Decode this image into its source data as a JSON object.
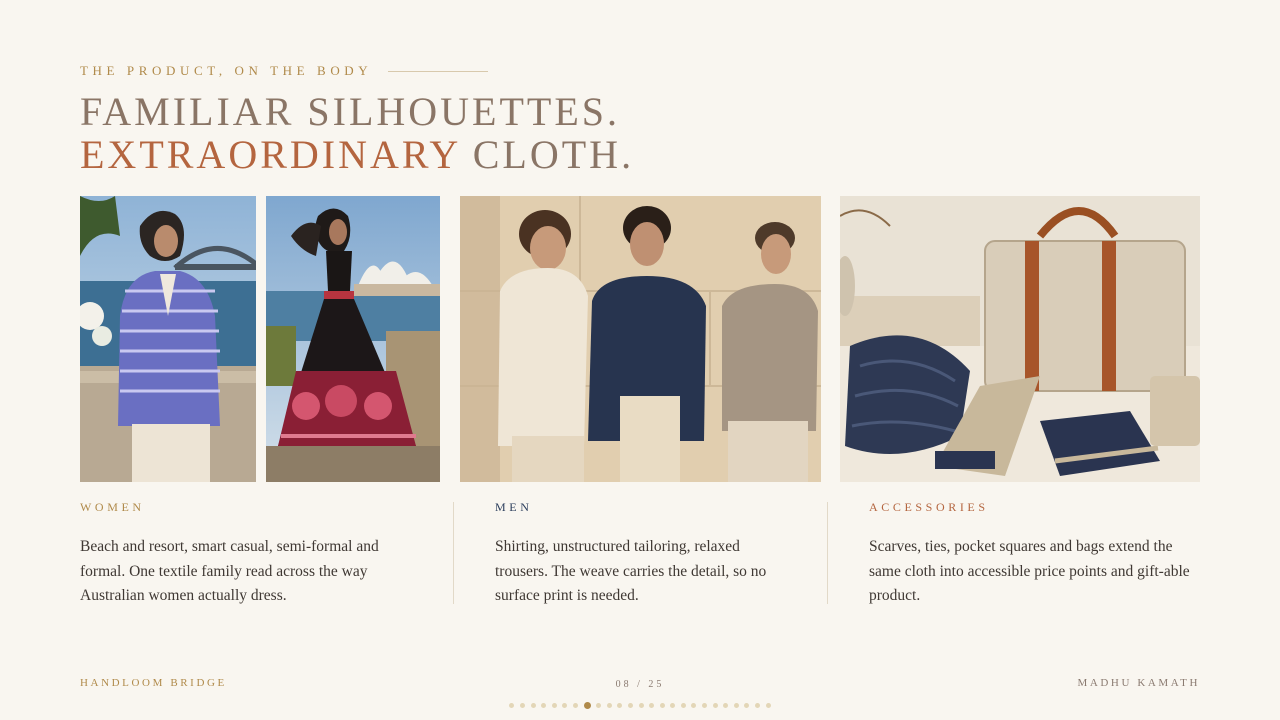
{
  "eyebrow": "THE PRODUCT, ON THE BODY",
  "headline": {
    "line1": "FAMILIAR SILHOUETTES.",
    "line2_accent": "EXTRAORDINARY",
    "line2_rest": " CLOTH."
  },
  "photos": {
    "women_blazer": "",
    "women_dress": "",
    "men_group": "",
    "accessories": ""
  },
  "columns": [
    {
      "label": "WOMEN",
      "label_color": "#b08a4a",
      "text": "Beach and resort, smart casual, semi-formal and formal. One textile family read across the way Australian women actually dress."
    },
    {
      "label": "MEN",
      "label_color": "#2c3e5c",
      "text": "Shirting, unstructured tailoring, relaxed trousers. The weave carries the detail, so no surface print is needed."
    },
    {
      "label": "ACCESSORIES",
      "label_color": "#b4653f",
      "text": "Scarves, ties, pocket squares and bags extend the same cloth into accessible price points and gift-able product."
    }
  ],
  "footer": {
    "left": "HANDLOOM BRIDGE",
    "page": "08 / 25",
    "right": "MADHU KAMATH"
  },
  "pagination": {
    "total": 25,
    "current": 8
  },
  "colors": {
    "background": "#f9f6f0",
    "gold": "#b08a4a",
    "rust": "#b4653f",
    "navy": "#2c3e5c"
  }
}
